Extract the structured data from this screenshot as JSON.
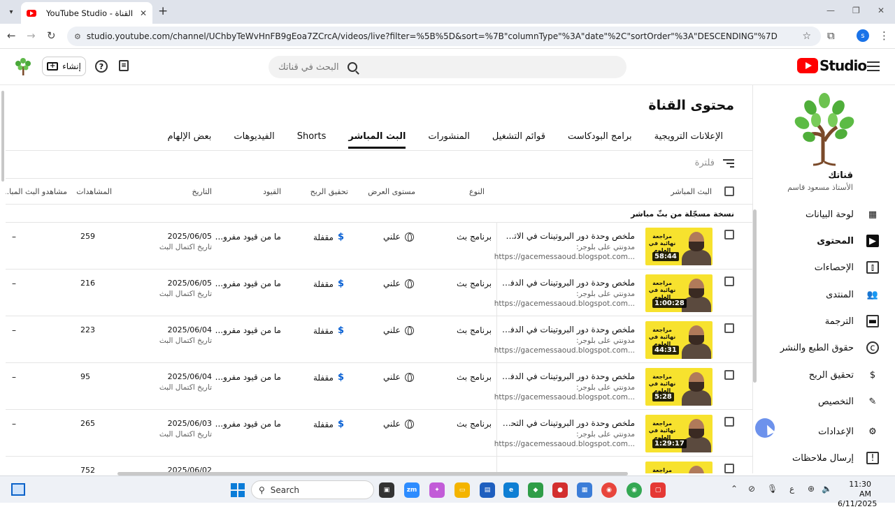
{
  "browser": {
    "tab_title": "YouTube Studio - محتوى القناة",
    "url": "studio.youtube.com/channel/UChbyTeWvHnFB9gEoa7ZCrcA/videos/live?filter=%5B%5D&sort=%7B\"columnType\"%3A\"date\"%2C\"sortOrder\"%3A\"DESCENDING\"%7D",
    "profile_initial": "s"
  },
  "header": {
    "logo_text": "Studio",
    "search_placeholder": "البحث في قناتك",
    "create_label": "إنشاء"
  },
  "sidebar": {
    "channel_name": "قناتك",
    "channel_owner": "الأستاذ مسعود قاسم",
    "items": [
      {
        "label": "لوحة البيانات",
        "icon": "dashboard-icon"
      },
      {
        "label": "المحتوى",
        "icon": "content-icon"
      },
      {
        "label": "الإحصاءات",
        "icon": "analytics-icon"
      },
      {
        "label": "المنتدى",
        "icon": "community-icon"
      },
      {
        "label": "الترجمة",
        "icon": "subtitles-icon"
      },
      {
        "label": "حقوق الطبع والنشر",
        "icon": "copyright-icon"
      },
      {
        "label": "تحقيق الربح",
        "icon": "monetization-icon"
      },
      {
        "label": "التخصيص",
        "icon": "customization-icon"
      },
      {
        "label": "الإعدادات",
        "icon": "settings-icon"
      },
      {
        "label": "إرسال ملاحظات",
        "icon": "feedback-icon"
      }
    ]
  },
  "main": {
    "title": "محتوى القناة",
    "tabs": [
      "بعض الإلهام",
      "الفيديوهات",
      "Shorts",
      "البث المباشر",
      "المنشورات",
      "قوائم التشغيل",
      "برامج البودكاست",
      "الإعلانات الترويجية"
    ],
    "active_tab": "البث المباشر",
    "filter_placeholder": "فلترة",
    "columns": {
      "live": "البث المباشر",
      "type": "النوع",
      "visibility": "مستوى العرض",
      "monetization": "تحقيق الربح",
      "restrictions": "القيود",
      "date": "التاريخ",
      "views": "المشاهدات",
      "live_viewers": "مشاهدو البث المبا..."
    },
    "group_label": "نسخة مسجّلة من بثّ مباشر",
    "rows": [
      {
        "title": "ملخص وحدة دور البروتينات في الاتصال ال...",
        "desc": "مدونتي على بلوجر:",
        "link": "https://gacemessaoud.blogspot.com...",
        "duration": "58:44",
        "type": "برنامج بث",
        "visibility": "علني",
        "monetization": "مقفلة",
        "restrictions": "ما من قيود مفرو...",
        "date": "2025/06/05",
        "date_sub": "تاريخ اكتمال البث",
        "views": "259",
        "live_viewers": "–"
      },
      {
        "title": "ملخص وحدة دور البروتينات في الدفاع عن...",
        "desc": "مدونتي على بلوجر:",
        "link": "https://gacemessaoud.blogspot.com...",
        "duration": "1:00:28",
        "type": "برنامج بث",
        "visibility": "علني",
        "monetization": "مقفلة",
        "restrictions": "ما من قيود مفرو...",
        "date": "2025/06/05",
        "date_sub": "تاريخ اكتمال البث",
        "views": "216",
        "live_viewers": "–"
      },
      {
        "title": "ملخص وحدة دور البروتينات في الدفاع عن...",
        "desc": "مدونتي على بلوجر:",
        "link": "https://gacemessaoud.blogspot.com...",
        "duration": "44:31",
        "type": "برنامج بث",
        "visibility": "علني",
        "monetization": "مقفلة",
        "restrictions": "ما من قيود مفرو...",
        "date": "2025/06/04",
        "date_sub": "تاريخ اكتمال البث",
        "views": "223",
        "live_viewers": "–"
      },
      {
        "title": "ملخص وحدة دور البروتينات في الدفاع عن...",
        "desc": "مدونتي على بلوجر:",
        "link": "https://gacemessaoud.blogspot.com...",
        "duration": "5:28",
        "type": "برنامج بث",
        "visibility": "علني",
        "monetization": "مقفلة",
        "restrictions": "ما من قيود مفرو...",
        "date": "2025/06/04",
        "date_sub": "تاريخ اكتمال البث",
        "views": "95",
        "live_viewers": "–"
      },
      {
        "title": "ملخص وحدة دور البروتينات في التحفيز الإن...",
        "desc": "مدونتي على بلوجر:",
        "link": "https://gacemessaoud.blogspot.com...",
        "duration": "1:29:17",
        "type": "برنامج بث",
        "visibility": "علني",
        "monetization": "مقفلة",
        "restrictions": "ما من قيود مفرو...",
        "date": "2025/06/03",
        "date_sub": "تاريخ اكتمال البث",
        "views": "265",
        "live_viewers": "–"
      },
      {
        "title": "",
        "desc": "",
        "link": "",
        "duration": "",
        "type": "",
        "visibility": "",
        "monetization": "",
        "restrictions": "",
        "date": "2025/06/02",
        "date_sub": "",
        "views": "752",
        "live_viewers": ""
      }
    ]
  },
  "thumbnail_text": "مراجعة نهائية في العلوم",
  "taskbar": {
    "search_label": "Search",
    "lang": "ع",
    "time": "11:30 AM",
    "date": "6/11/2025"
  }
}
